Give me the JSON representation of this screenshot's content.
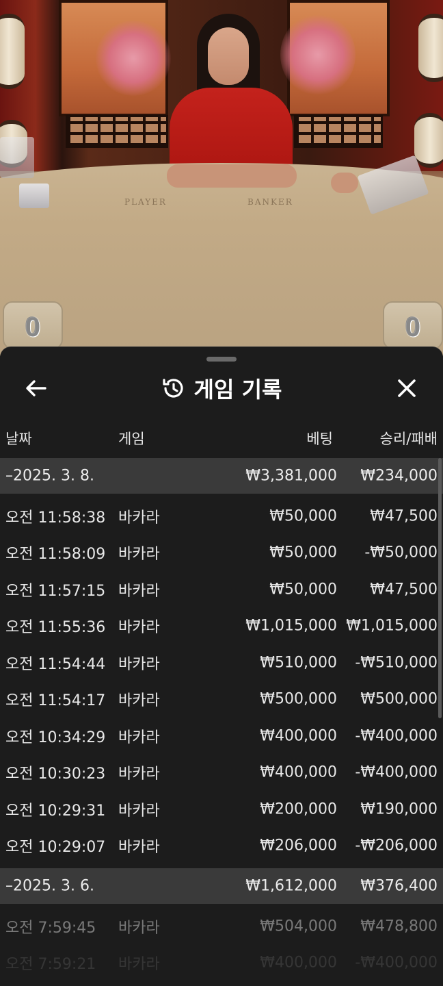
{
  "video": {
    "table_labels": [
      "PLAYER",
      "BANKER"
    ],
    "score_left": "0",
    "score_right": "0"
  },
  "sheet": {
    "title": "게임 기록",
    "icons": {
      "back": "back-arrow-icon",
      "history": "history-clock-icon",
      "close": "close-icon"
    }
  },
  "columns": {
    "date": "날짜",
    "game": "게임",
    "bet": "베팅",
    "result": "승리/패배"
  },
  "groups": [
    {
      "date": "–2025. 3. 8.",
      "bet_total": "₩3,381,000",
      "result_total": "₩234,000",
      "rows": [
        {
          "time": "오전 11:58:38",
          "game": "바카라",
          "bet": "₩50,000",
          "result": "₩47,500"
        },
        {
          "time": "오전 11:58:09",
          "game": "바카라",
          "bet": "₩50,000",
          "result": "-₩50,000"
        },
        {
          "time": "오전 11:57:15",
          "game": "바카라",
          "bet": "₩50,000",
          "result": "₩47,500"
        },
        {
          "time": "오전 11:55:36",
          "game": "바카라",
          "bet": "₩1,015,000",
          "result": "₩1,015,000"
        },
        {
          "time": "오전 11:54:44",
          "game": "바카라",
          "bet": "₩510,000",
          "result": "-₩510,000"
        },
        {
          "time": "오전 11:54:17",
          "game": "바카라",
          "bet": "₩500,000",
          "result": "₩500,000"
        },
        {
          "time": "오전 10:34:29",
          "game": "바카라",
          "bet": "₩400,000",
          "result": "-₩400,000"
        },
        {
          "time": "오전 10:30:23",
          "game": "바카라",
          "bet": "₩400,000",
          "result": "-₩400,000"
        },
        {
          "time": "오전 10:29:31",
          "game": "바카라",
          "bet": "₩200,000",
          "result": "₩190,000"
        },
        {
          "time": "오전 10:29:07",
          "game": "바카라",
          "bet": "₩206,000",
          "result": "-₩206,000"
        }
      ]
    },
    {
      "date": "–2025. 3. 6.",
      "bet_total": "₩1,612,000",
      "result_total": "₩376,400",
      "rows": [
        {
          "time": "오전 7:59:45",
          "game": "바카라",
          "bet": "₩504,000",
          "result": "₩478,800"
        },
        {
          "time": "오전 7:59:21",
          "game": "바카라",
          "bet": "₩400,000",
          "result": "-₩400,000"
        }
      ]
    }
  ]
}
